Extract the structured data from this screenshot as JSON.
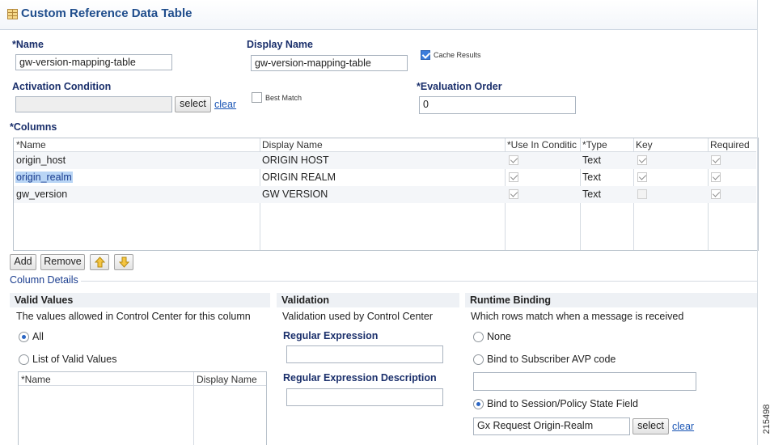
{
  "header": {
    "title": "Custom Reference Data Table"
  },
  "form": {
    "name_label": "*Name",
    "name_value": "gw-version-mapping-table",
    "display_name_label": "Display Name",
    "display_name_value": "gw-version-mapping-table",
    "cache_results_label": "Cache Results",
    "activation_label": "Activation Condition",
    "activation_value": "",
    "select_label": "select",
    "clear_label": "clear",
    "best_match_label": "Best Match",
    "eval_order_label": "*Evaluation Order",
    "eval_order_value": "0",
    "columns_label": "*Columns"
  },
  "columns_table": {
    "headers": [
      "*Name",
      "Display Name",
      "*Use In Conditic",
      "*Type",
      "Key",
      "Required"
    ],
    "rows": [
      {
        "name": "origin_host",
        "display": "ORIGIN HOST",
        "use": true,
        "type": "Text",
        "key": true,
        "required": true
      },
      {
        "name": "origin_realm",
        "display": "ORIGIN REALM",
        "use": true,
        "type": "Text",
        "key": true,
        "required": true
      },
      {
        "name": "gw_version",
        "display": "GW VERSION",
        "use": true,
        "type": "Text",
        "key": false,
        "required": true
      }
    ]
  },
  "toolbar": {
    "add": "Add",
    "remove": "Remove"
  },
  "column_details": {
    "title": "Column Details",
    "valid_values": {
      "title": "Valid Values",
      "desc": "The values allowed in Control Center for this column",
      "all_label": "All",
      "list_label": "List of Valid Values",
      "table_headers": [
        "*Name",
        "Display Name"
      ]
    },
    "validation": {
      "title": "Validation",
      "desc": "Validation used by Control Center",
      "regex_label": "Regular Expression",
      "regex_value": "",
      "regex_desc_label": "Regular Expression Description",
      "regex_desc_value": ""
    },
    "runtime": {
      "title": "Runtime Binding",
      "desc": "Which rows match when a message is received",
      "none_label": "None",
      "avp_label": "Bind to Subscriber AVP code",
      "avp_value": "",
      "session_label": "Bind to Session/Policy State Field",
      "session_value": "Gx Request Origin-Realm",
      "select_label": "select",
      "clear_label": "clear"
    }
  },
  "figure_id": "215498",
  "colors": {
    "accent": "#1f4d8c",
    "label": "#1a2f6b",
    "link": "#1a55b5",
    "selection": "#b9d5f5"
  }
}
